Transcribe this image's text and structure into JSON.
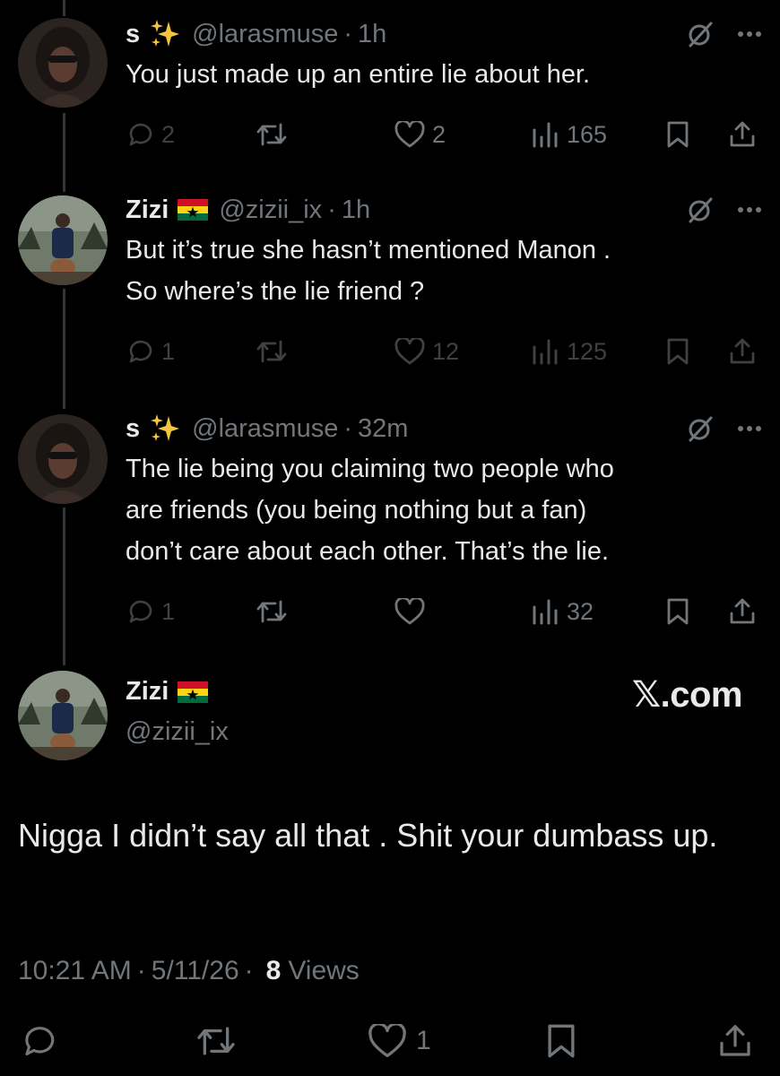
{
  "replies": [
    {
      "display_name": "s",
      "badge_icon": "sparkles-emoji",
      "handle": "@larasmuse",
      "time": "1h",
      "text": "You just made up an entire lie about her.",
      "counts": {
        "reply": "2",
        "repost": "",
        "like": "2",
        "views": "165"
      }
    },
    {
      "display_name": "Zizi",
      "badge_icon": "ghana-flag-emoji",
      "handle": "@zizii_ix",
      "time": "1h",
      "text": "But it’s true she hasn’t mentioned Manon .\nSo where’s the lie friend ?",
      "counts": {
        "reply": "1",
        "repost": "",
        "like": "12",
        "views": "125"
      }
    },
    {
      "display_name": "s",
      "badge_icon": "sparkles-emoji",
      "handle": "@larasmuse",
      "time": "32m",
      "text": "The lie being you claiming two people who\nare friends (you being nothing but a fan)\ndon’t care about each other. That’s the lie.",
      "counts": {
        "reply": "1",
        "repost": "",
        "like": "",
        "views": "32"
      }
    }
  ],
  "main_post": {
    "display_name": "Zizi",
    "badge_icon": "ghana-flag-emoji",
    "handle": "@zizii_ix",
    "watermark": "𝕏.com",
    "text": "Nigga I didn’t say all that . Shit your dumbass up.",
    "time": "10:21 AM",
    "date": "5/11/26",
    "views_count": "8",
    "views_label": "Views",
    "like_count": "1"
  },
  "separator": "·",
  "colors": {
    "background": "#000000",
    "text": "#e7e9ea",
    "muted": "#71767b",
    "thread_line": "#333639"
  }
}
